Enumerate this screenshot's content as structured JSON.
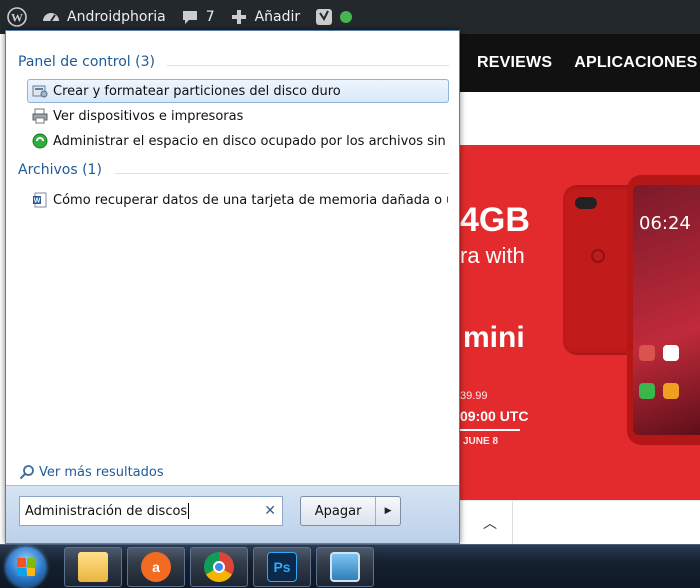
{
  "adminbar": {
    "site_name": "Androidphoria",
    "comments_count": "7",
    "new_label": "Añadir",
    "status_color": "#46b450"
  },
  "site": {
    "nav": [
      "REVIEWS",
      "APLICACIONES"
    ],
    "banner": {
      "headline": "4GB",
      "subline": "ra with",
      "model": "mini",
      "price": "39.99",
      "time": "09:00 UTC",
      "date": "JUNE 8",
      "clock": "06:24",
      "color": "#e32b2d"
    }
  },
  "start_menu": {
    "groups": [
      {
        "title": "Panel de control (3)",
        "items": [
          {
            "label": "Crear y formatear particiones del disco duro",
            "icon": "disk-management-icon",
            "selected": true
          },
          {
            "label": "Ver dispositivos e impresoras",
            "icon": "printer-icon",
            "selected": false
          },
          {
            "label": "Administrar el espacio en disco ocupado por los archivos sin co...",
            "icon": "green-recycle-icon",
            "selected": false
          }
        ]
      },
      {
        "title": "Archivos (1)",
        "items": [
          {
            "label": "Cómo recuperar datos de una tarjeta de memoria dañada o uni...",
            "icon": "word-document-icon",
            "selected": false
          }
        ]
      }
    ],
    "more_results": "Ver más resultados",
    "search_value": "Administración de discos",
    "shutdown_label": "Apagar"
  },
  "taskbar": {
    "apps": [
      "explorer-icon",
      "avast-icon",
      "chrome-icon",
      "photoshop-icon",
      "image-viewer-icon"
    ]
  }
}
